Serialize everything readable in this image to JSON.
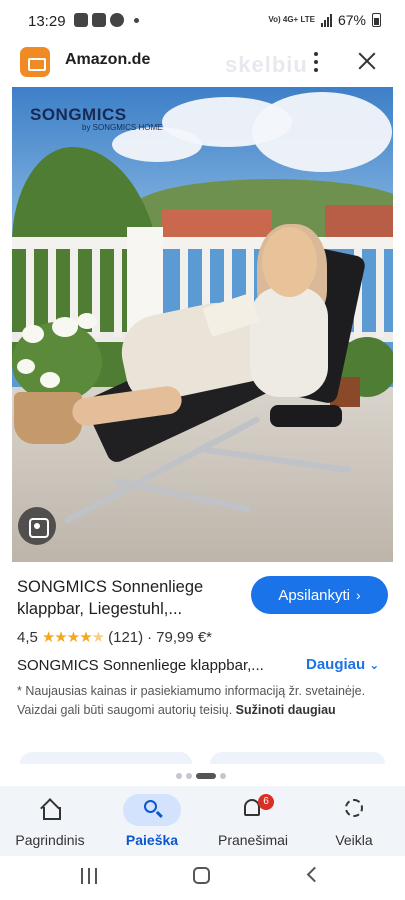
{
  "status_bar": {
    "time": "13:29",
    "network_label": "Vo) 4G+ LTE",
    "battery": "67%"
  },
  "header": {
    "site": "Amazon.de",
    "watermark": "skelbiu"
  },
  "image": {
    "brand": "SONGMICS",
    "brand_sub": "by SONGMICS HOME"
  },
  "product": {
    "title": "SONGMICS Sonnenliege klappbar, Liegestuhl,...",
    "visit_label": "Apsilankyti",
    "rating": "4,5",
    "stars_value": 4.5,
    "reviews": "(121)",
    "separator": "·",
    "price": "79,99 €*",
    "description": "SONGMICS Sonnenliege klappbar,...",
    "more_label": "Daugiau",
    "note_text": "* Naujausias kainas ir pasiekiamumo informaciją žr. svetainėje. Vaizdai gali būti saugomi autorių teisių.",
    "note_link": "Sužinoti daugiau"
  },
  "pager": {
    "count": 4,
    "active_index": 2
  },
  "bottom_nav": [
    {
      "label": "Pagrindinis",
      "icon": "home-icon",
      "active": false
    },
    {
      "label": "Paieška",
      "icon": "search-icon",
      "active": true
    },
    {
      "label": "Pranešimai",
      "icon": "bell-icon",
      "active": false,
      "badge": "6"
    },
    {
      "label": "Veikla",
      "icon": "activity-icon",
      "active": false
    }
  ],
  "colors": {
    "accent": "#1a73e8",
    "active_nav_bg": "#d3e3fd",
    "star": "#f4a81d",
    "badge": "#d93025",
    "amazon_logo": "#f08a24"
  }
}
